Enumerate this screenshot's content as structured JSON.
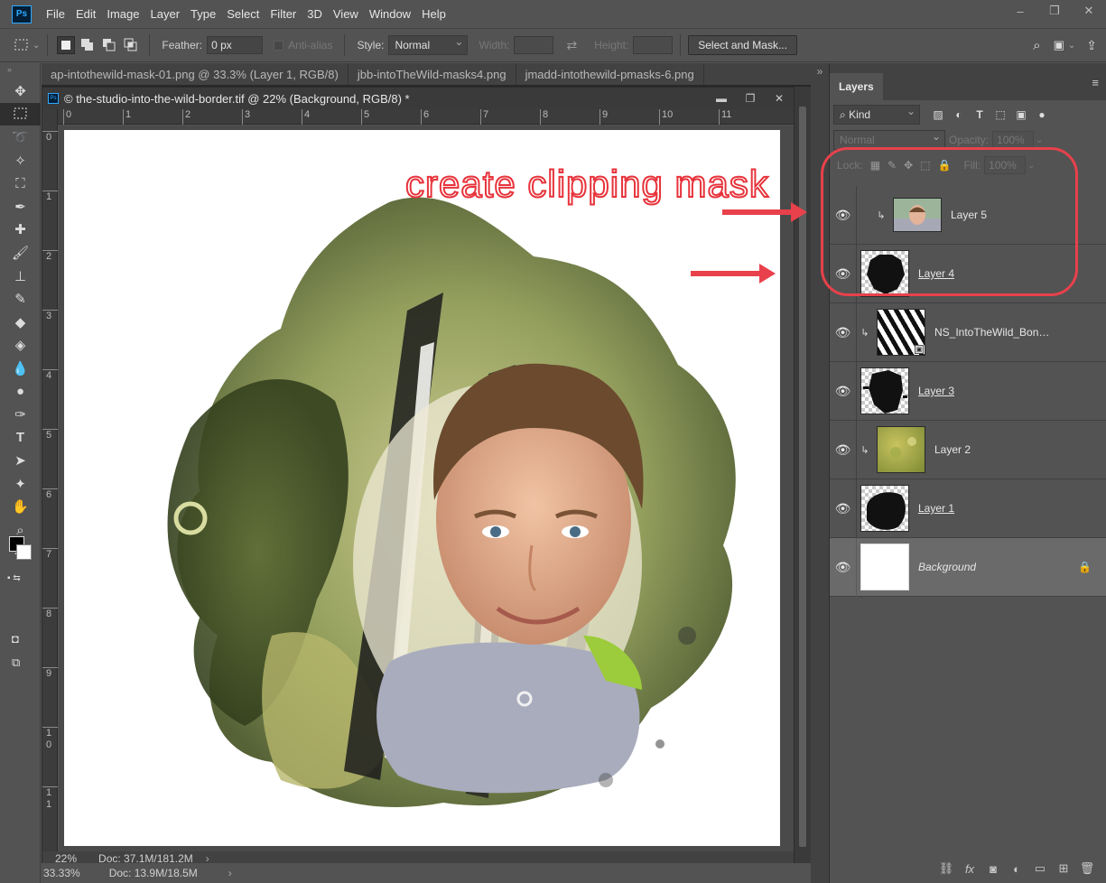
{
  "menu": {
    "items": [
      "File",
      "Edit",
      "Image",
      "Layer",
      "Type",
      "Select",
      "Filter",
      "3D",
      "View",
      "Window",
      "Help"
    ],
    "logo": "Ps"
  },
  "window_controls": {
    "minimize": "–",
    "restore": "❐",
    "close": "✕"
  },
  "options": {
    "feather_label": "Feather:",
    "feather_value": "0 px",
    "anti_alias_label": "Anti-alias",
    "style_label": "Style:",
    "style_value": "Normal",
    "width_label": "Width:",
    "height_label": "Height:",
    "select_mask_button": "Select and Mask..."
  },
  "tabs": [
    {
      "label": "ap-intothewild-mask-01.png @ 33.3% (Layer 1, RGB/8)"
    },
    {
      "label": "jbb-intoTheWild-masks4.png"
    },
    {
      "label": "jmadd-intothewild-pmasks-6.png"
    }
  ],
  "tab_overflow": "»",
  "document": {
    "title": "© the-studio-into-the-wild-border.tif @ 22% (Background, RGB/8) *",
    "zoom": "22%",
    "doc_size": "Doc: 37.1M/181.2M",
    "ruler_h": [
      "0",
      "1",
      "2",
      "3",
      "4",
      "5",
      "6",
      "7",
      "8",
      "9",
      "10",
      "11"
    ],
    "ruler_v": [
      "0",
      "1",
      "2",
      "3",
      "4",
      "5",
      "6",
      "7",
      "8",
      "9",
      "1\n0",
      "1\n1"
    ]
  },
  "main_status": {
    "zoom": "33.33%",
    "doc_size": "Doc: 13.9M/18.5M"
  },
  "annotation": {
    "text": "create clipping mask"
  },
  "layers_panel": {
    "tab_label": "Layers",
    "kind_label": "Kind",
    "blend_mode": "Normal",
    "opacity_label": "Opacity:",
    "opacity_value": "100%",
    "lock_label": "Lock:",
    "fill_label": "Fill:",
    "fill_value": "100%",
    "layers": [
      {
        "name": "Layer 5",
        "clipped": true,
        "mask": false,
        "selected": false
      },
      {
        "name": "Layer 4",
        "clipped": false,
        "mask": true,
        "selected": false
      },
      {
        "name": "NS_IntoTheWild_Bonus...",
        "clipped": true,
        "mask": false,
        "selected": false
      },
      {
        "name": "Layer 3",
        "clipped": false,
        "mask": true,
        "selected": false
      },
      {
        "name": "Layer 2",
        "clipped": true,
        "mask": false,
        "selected": false
      },
      {
        "name": "Layer 1",
        "clipped": false,
        "mask": true,
        "selected": false
      },
      {
        "name": "Background",
        "clipped": false,
        "mask": false,
        "selected": true,
        "locked": true
      }
    ]
  },
  "colors": {
    "annotation_red": "#e8414b",
    "ps_blue": "#31a8ff"
  }
}
